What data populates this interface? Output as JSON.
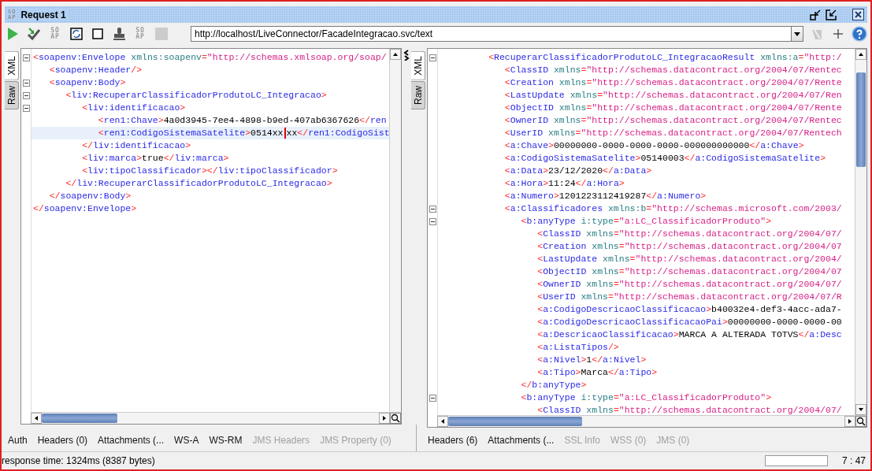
{
  "window": {
    "logo": [
      "SO",
      "AP"
    ],
    "title": "Request 1"
  },
  "toolbar": {
    "left_icons": [
      {
        "kind": "play",
        "disabled": false
      },
      {
        "kind": "check",
        "disabled": false
      },
      {
        "kind": "soap",
        "lines": [
          "SO",
          "AP"
        ],
        "disabled": true
      },
      {
        "kind": "refresh",
        "disabled": false
      },
      {
        "kind": "square",
        "disabled": false
      },
      {
        "kind": "stamp",
        "disabled": false
      },
      {
        "kind": "soap",
        "lines": [
          "SO",
          "AP"
        ],
        "disabled": true
      },
      {
        "kind": "stop",
        "disabled": true
      }
    ],
    "url": "http://localhost/LiveConnector/FacadeIntegracao.svc/text",
    "right_icons": [
      {
        "kind": "flag",
        "disabled": true
      },
      {
        "kind": "plus",
        "disabled": false
      },
      {
        "kind": "help",
        "disabled": false
      }
    ]
  },
  "request": {
    "view_tabs": [
      {
        "label": "XML",
        "selected": true
      },
      {
        "label": "Raw",
        "selected": false
      }
    ],
    "lines": [
      {
        "text": "<soapenv:Envelope xmlns:soapenv=\"http://schemas.xmlsoap.org/soap/",
        "foldable": true,
        "current": false
      },
      {
        "text": "   <soapenv:Header/>",
        "foldable": false,
        "current": false
      },
      {
        "text": "   <soapenv:Body>",
        "foldable": true,
        "current": false
      },
      {
        "text": "      <liv:RecuperarClassificadorProdutoLC_Integracao>",
        "foldable": true,
        "current": false
      },
      {
        "text": "         <liv:identificacao>",
        "foldable": true,
        "current": false
      },
      {
        "text": "            <ren1:Chave>4a0d3945-7ee4-4898-b9ed-407ab6367626</ren",
        "foldable": false,
        "current": false
      },
      {
        "text": "            <ren1:CodigoSistemaSatelite>0514xx",
        "after_caret": "xx</ren1:CodigoSist",
        "foldable": false,
        "current": true
      },
      {
        "text": "         </liv:identificacao>",
        "foldable": false,
        "current": false
      },
      {
        "text": "         <liv:marca>true</liv:marca>",
        "foldable": false,
        "current": false
      },
      {
        "text": "         <liv:tipoClassificador></liv:tipoClassificador>",
        "foldable": false,
        "current": false
      },
      {
        "text": "      </liv:RecuperarClassificadorProdutoLC_Integracao>",
        "foldable": false,
        "current": false
      },
      {
        "text": "   </soapenv:Body>",
        "foldable": false,
        "current": false
      },
      {
        "text": "</soapenv:Envelope>",
        "foldable": false,
        "current": false
      }
    ],
    "bottom_tabs": [
      {
        "label": "Auth",
        "disabled": false
      },
      {
        "label": "Headers (0)",
        "disabled": false
      },
      {
        "label": "Attachments (...",
        "disabled": false
      },
      {
        "label": "WS-A",
        "disabled": false
      },
      {
        "label": "WS-RM",
        "disabled": false
      },
      {
        "label": "JMS Headers",
        "disabled": true
      },
      {
        "label": "JMS Property (0)",
        "disabled": true
      }
    ]
  },
  "response": {
    "view_tabs": [
      {
        "label": "XML",
        "selected": true
      },
      {
        "label": "Raw",
        "selected": false
      }
    ],
    "lines": [
      {
        "text": "         <RecuperarClassificadorProdutoLC_IntegracaoResult xmlns:a=\"http:/",
        "foldable": true,
        "current": false
      },
      {
        "text": "            <ClassID xmlns=\"http://schemas.datacontract.org/2004/07/Rentec",
        "foldable": false,
        "current": false
      },
      {
        "text": "            <Creation xmlns=\"http://schemas.datacontract.org/2004/07/Rente",
        "foldable": false,
        "current": false
      },
      {
        "text": "            <LastUpdate xmlns=\"http://schemas.datacontract.org/2004/07/Ren",
        "foldable": false,
        "current": false
      },
      {
        "text": "            <ObjectID xmlns=\"http://schemas.datacontract.org/2004/07/Rente",
        "foldable": false,
        "current": false
      },
      {
        "text": "            <OwnerID xmlns=\"http://schemas.datacontract.org/2004/07/Rentec",
        "foldable": false,
        "current": false
      },
      {
        "text": "            <UserID xmlns=\"http://schemas.datacontract.org/2004/07/Rentech",
        "foldable": false,
        "current": false
      },
      {
        "text": "            <a:Chave>00000000-0000-0000-0000-000000000000</a:Chave>",
        "foldable": false,
        "current": false
      },
      {
        "text": "            <a:CodigoSistemaSatelite>05140003</a:CodigoSistemaSatelite>",
        "foldable": false,
        "current": false
      },
      {
        "text": "            <a:Data>23/12/2020</a:Data>",
        "foldable": false,
        "current": false
      },
      {
        "text": "            <a:Hora>11:24</a:Hora>",
        "foldable": false,
        "current": false
      },
      {
        "text": "            <a:Numero>1201223112419287</a:Numero>",
        "foldable": false,
        "current": false
      },
      {
        "text": "            <a:Classificadores xmlns:b=\"http://schemas.microsoft.com/2003/",
        "foldable": true,
        "current": false
      },
      {
        "text": "               <b:anyType i:type=\"a:LC_ClassificadorProduto\">",
        "foldable": true,
        "current": false
      },
      {
        "text": "                  <ClassID xmlns=\"http://schemas.datacontract.org/2004/07/",
        "foldable": false,
        "current": false
      },
      {
        "text": "                  <Creation xmlns=\"http://schemas.datacontract.org/2004/07",
        "foldable": false,
        "current": false
      },
      {
        "text": "                  <LastUpdate xmlns=\"http://schemas.datacontract.org/2004/",
        "foldable": false,
        "current": false
      },
      {
        "text": "                  <ObjectID xmlns=\"http://schemas.datacontract.org/2004/07",
        "foldable": false,
        "current": false
      },
      {
        "text": "                  <OwnerID xmlns=\"http://schemas.datacontract.org/2004/07/",
        "foldable": false,
        "current": false
      },
      {
        "text": "                  <UserID xmlns=\"http://schemas.datacontract.org/2004/07/R",
        "foldable": false,
        "current": false
      },
      {
        "text": "                  <a:CodigoDescricaoClassificacao>b40032e4-def3-4acc-ada7-",
        "foldable": false,
        "current": false
      },
      {
        "text": "                  <a:CodigoDescricaoClassificacaoPai>00000000-0000-0000-00",
        "foldable": false,
        "current": false
      },
      {
        "text": "                  <a:DescricaoClassificacao>MARCA A ALTERADA TOTVS</a:Desc",
        "foldable": false,
        "current": false
      },
      {
        "text": "                  <a:ListaTipos/>",
        "foldable": false,
        "current": false
      },
      {
        "text": "                  <a:Nivel>1</a:Nivel>",
        "foldable": false,
        "current": false
      },
      {
        "text": "                  <a:Tipo>Marca</a:Tipo>",
        "foldable": false,
        "current": false
      },
      {
        "text": "               </b:anyType>",
        "foldable": false,
        "current": false
      },
      {
        "text": "               <b:anyType i:type=\"a:LC_ClassificadorProduto\">",
        "foldable": true,
        "current": false
      },
      {
        "text": "                  <ClassID xmlns=\"http://schemas.datacontract.org/2004/07/",
        "foldable": false,
        "current": false
      }
    ],
    "bottom_tabs": [
      {
        "label": "Headers (6)",
        "disabled": false
      },
      {
        "label": "Attachments (...",
        "disabled": false
      },
      {
        "label": "SSL Info",
        "disabled": true
      },
      {
        "label": "WSS (0)",
        "disabled": true
      },
      {
        "label": "JMS (0)",
        "disabled": true
      }
    ]
  },
  "status_bar": {
    "message": "response time: 1324ms (8387 bytes)",
    "position": "7 : 47"
  }
}
